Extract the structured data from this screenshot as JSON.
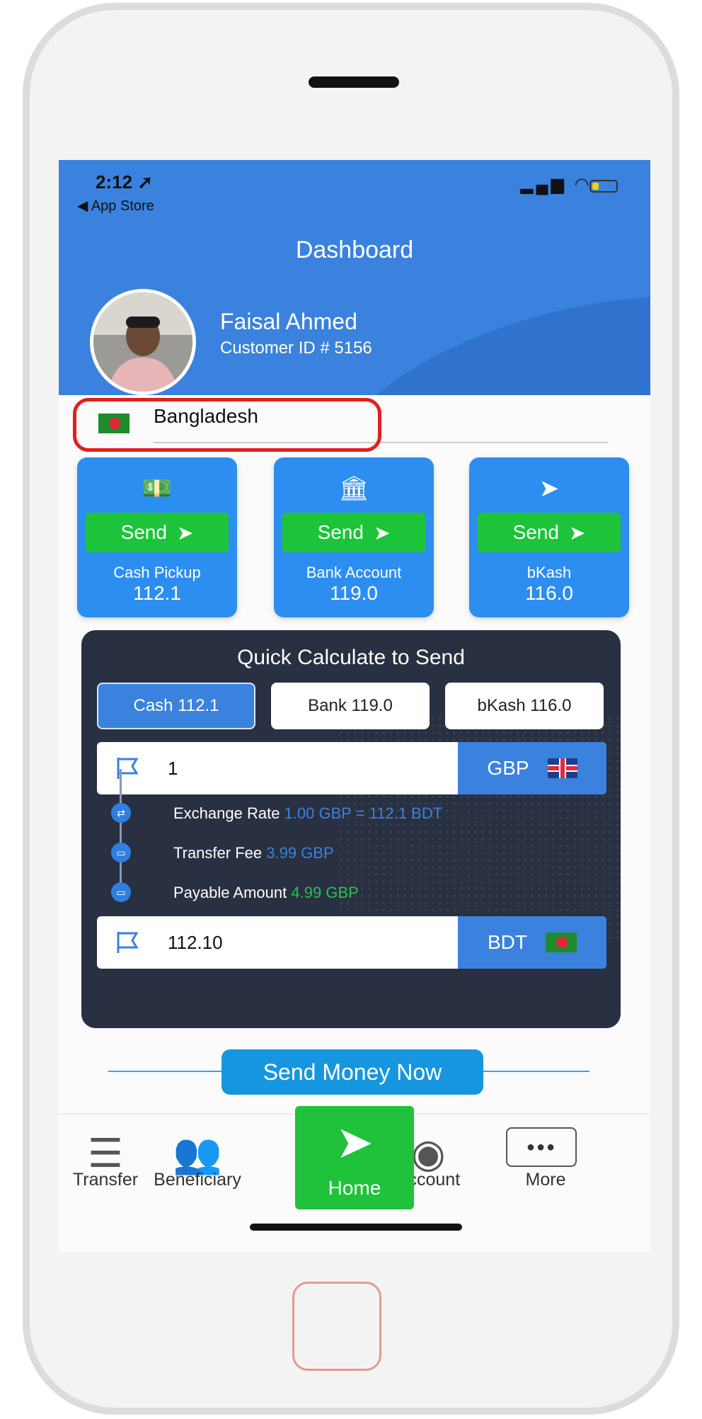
{
  "status_bar": {
    "time": "2:12",
    "back_label": "◀ App Store",
    "signal": "▂▄▆",
    "wifi": "wifi-icon"
  },
  "header": {
    "title": "Dashboard",
    "user_name": "Faisal Ahmed",
    "customer_id": "Customer ID # 5156"
  },
  "country": {
    "name": "Bangladesh"
  },
  "services": [
    {
      "icon": "💵",
      "send_label": "Send",
      "label": "Cash Pickup",
      "value": "112.1"
    },
    {
      "icon": "🏛",
      "send_label": "Send",
      "label": "Bank Account",
      "value": "119.0"
    },
    {
      "icon": "➤",
      "send_label": "Send",
      "label": "bKash",
      "value": "116.0"
    }
  ],
  "calculator": {
    "title": "Quick Calculate to Send",
    "tabs": [
      "Cash 112.1",
      "Bank 119.0",
      "bKash 116.0"
    ],
    "send_amount": "1",
    "send_currency": "GBP",
    "receive_amount": "112.10",
    "receive_currency": "BDT",
    "exchange_label": "Exchange Rate",
    "exchange_value": "1.00 GBP = 112.1 BDT",
    "fee_label": "Transfer Fee",
    "fee_value": "3.99 GBP",
    "payable_label": "Payable Amount",
    "payable_value": "4.99 GBP"
  },
  "send_money_now": "Send Money Now",
  "tabbar": {
    "transfer": "Transfer",
    "beneficiary": "Beneficiary",
    "home": "Home",
    "account": "Account",
    "more": "More"
  },
  "colors": {
    "primary": "#3a82de",
    "green": "#1fc23a",
    "dark_panel": "#283041",
    "highlight": "#e41d1d"
  }
}
